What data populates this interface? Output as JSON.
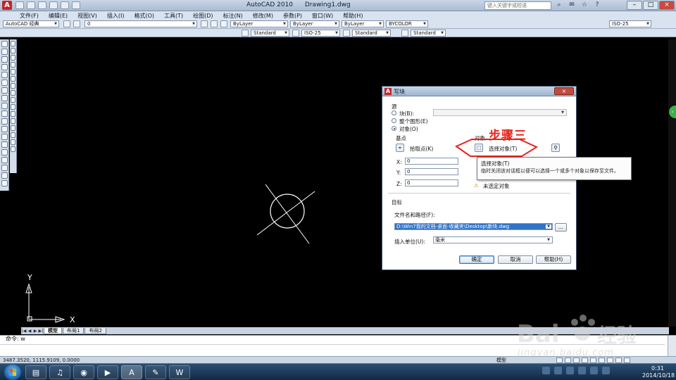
{
  "title": {
    "app": "AutoCAD 2010",
    "file": "Drawing1.dwg",
    "search_placeholder": "键入关键字或短语"
  },
  "menu": {
    "items": [
      "文件(F)",
      "编辑(E)",
      "视图(V)",
      "插入(I)",
      "格式(O)",
      "工具(T)",
      "绘图(D)",
      "标注(N)",
      "修改(M)",
      "参数(P)",
      "窗口(W)",
      "帮助(H)"
    ],
    "text_style": "Standard",
    "dim_style": "ISO-25",
    "table_style": "Standard",
    "mleader_style": "Standard"
  },
  "toolbar": {
    "workspace": "AutoCAD 经典",
    "layer": "0",
    "color": "ByLayer",
    "linetype": "ByLayer",
    "lineweight": "ByLayer",
    "plotstyle": "BYCOLOR",
    "dim_scale": "ISO-25"
  },
  "canvas": {
    "ucs_y": "Y",
    "ucs_x": "X"
  },
  "layout_tabs": [
    "模型",
    "布局1",
    "布局2"
  ],
  "command": {
    "line1": "命令: w"
  },
  "status": {
    "coords": "3487.3520, 1115.9109, 0.0000",
    "model": "模型"
  },
  "dialog": {
    "title": "写块",
    "source": {
      "label": "源",
      "block": "块(B):",
      "entire": "整个图形(E)",
      "objects": "对象(O)",
      "selected": "objects"
    },
    "base_point": {
      "label": "基点",
      "pick": "拾取点(K)",
      "x_label": "X:",
      "x": "0",
      "y_label": "Y:",
      "y": "0",
      "z_label": "Z:",
      "z": "0"
    },
    "objects": {
      "label": "对象",
      "select": "选择对象(T)",
      "warning": "未选定对象"
    },
    "destination": {
      "label": "目标",
      "path_label": "文件名和路径(F):",
      "path": "D:\\Win7我的文档-桌面-收藏夹\\Desktop\\新块.dwg",
      "units_label": "插入单位(U):",
      "units": "毫米"
    },
    "buttons": {
      "ok": "确定",
      "cancel": "取消",
      "help": "帮助(H)",
      "browse": "..."
    }
  },
  "annotation": {
    "step": "步骤三"
  },
  "tooltip": {
    "title": "选择对象(T)",
    "desc": "临时关闭该对话框以便可以选择一个或多个对象以保存至文件。"
  },
  "taskbar": {
    "time": "0:31",
    "date": "2014/10/18"
  },
  "watermark": {
    "text": "jingyan.baidu.com"
  },
  "colors": {
    "step_red": "#e8231b",
    "select_blue": "#3173c7",
    "canvas": "#000000"
  }
}
